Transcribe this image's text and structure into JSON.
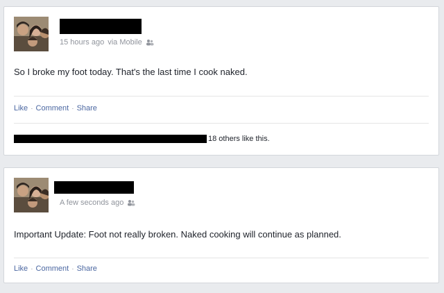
{
  "posts": [
    {
      "meta": {
        "time": "15 hours ago",
        "via": "via Mobile"
      },
      "status": "So I broke my foot today. That's the last time I cook naked.",
      "actions": {
        "like": "Like",
        "comment": "Comment",
        "share": "Share"
      },
      "likes_text": "18 others like this."
    },
    {
      "meta": {
        "time": "A few seconds ago"
      },
      "status": "Important Update: Foot not really broken. Naked cooking will continue as planned.",
      "actions": {
        "like": "Like",
        "comment": "Comment",
        "share": "Share"
      }
    }
  ],
  "icons": {
    "audience": "friends-icon",
    "separator": "·"
  },
  "colors": {
    "link": "#4b67a1",
    "meta": "#90949c",
    "text": "#1d2129",
    "background": "#e9ebee"
  }
}
